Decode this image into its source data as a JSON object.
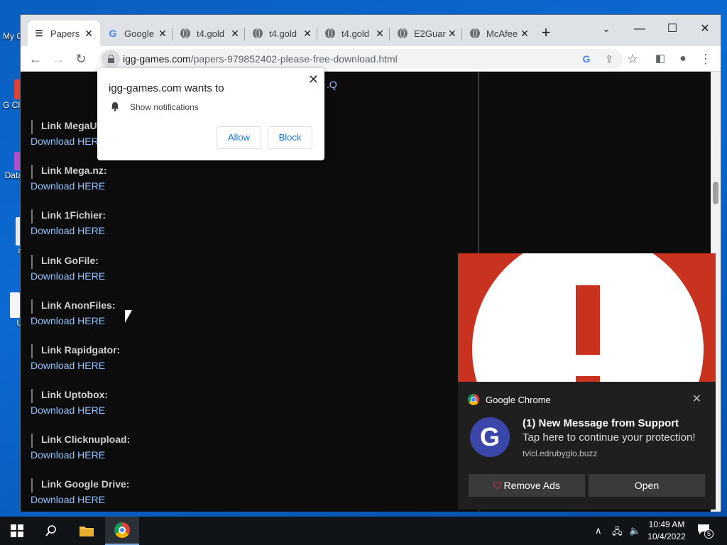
{
  "desktop": {
    "icons": [
      {
        "label": "My C",
        "color": "#3d7bd9"
      },
      {
        "label": "G Ch",
        "color": "#e0423a"
      },
      {
        "label": "Data",
        "color": "#b04fd0"
      },
      {
        "label": "a",
        "color": "#e8e8e8"
      },
      {
        "label": "U",
        "color": "#f5f5f5"
      }
    ]
  },
  "browser": {
    "tabs": [
      {
        "title": "Papers",
        "icon": "page-icon"
      },
      {
        "title": "Google",
        "icon": "google-icon"
      },
      {
        "title": "t4.gold",
        "icon": "globe-icon"
      },
      {
        "title": "t4.gold",
        "icon": "globe-icon"
      },
      {
        "title": "t4.gold",
        "icon": "globe-icon"
      },
      {
        "title": "E2Guar",
        "icon": "globe-icon"
      },
      {
        "title": "McAfee",
        "icon": "globe-icon"
      }
    ],
    "new_tab": "+",
    "url_host": "igg-games.com",
    "url_path": "/papers-979852402-please-free-download.html"
  },
  "page": {
    "stray_text": ".Q",
    "links": [
      {
        "title": "Link MegaUp",
        "download": "Download HERE"
      },
      {
        "title": "Link Mega.nz:",
        "download": "Download HERE"
      },
      {
        "title": "Link 1Fichier:",
        "download": "Download HERE"
      },
      {
        "title": "Link GoFile:",
        "download": "Download HERE"
      },
      {
        "title": "Link AnonFiles:",
        "download": "Download HERE"
      },
      {
        "title": "Link Rapidgator:",
        "download": "Download HERE"
      },
      {
        "title": "Link Uptobox:",
        "download": "Download HERE"
      },
      {
        "title": "Link Clicknupload:",
        "download": "Download HERE"
      },
      {
        "title": "Link Google Drive:",
        "download": "Download HERE"
      }
    ]
  },
  "permission": {
    "title": "igg-games.com wants to",
    "request": "Show notifications",
    "allow": "Allow",
    "block": "Block"
  },
  "notification": {
    "source": "Google Chrome",
    "avatar_letter": "G",
    "headline": "(1) New Message from Support",
    "body": "Tap here to continue your protection!",
    "domain": "tvlcl.edrubyglo.buzz",
    "remove_ads": "Remove Ads",
    "open": "Open",
    "banner_color": "#c8321e"
  },
  "taskbar": {
    "time": "10:49 AM",
    "date": "10/4/2022",
    "notification_count": "5"
  }
}
